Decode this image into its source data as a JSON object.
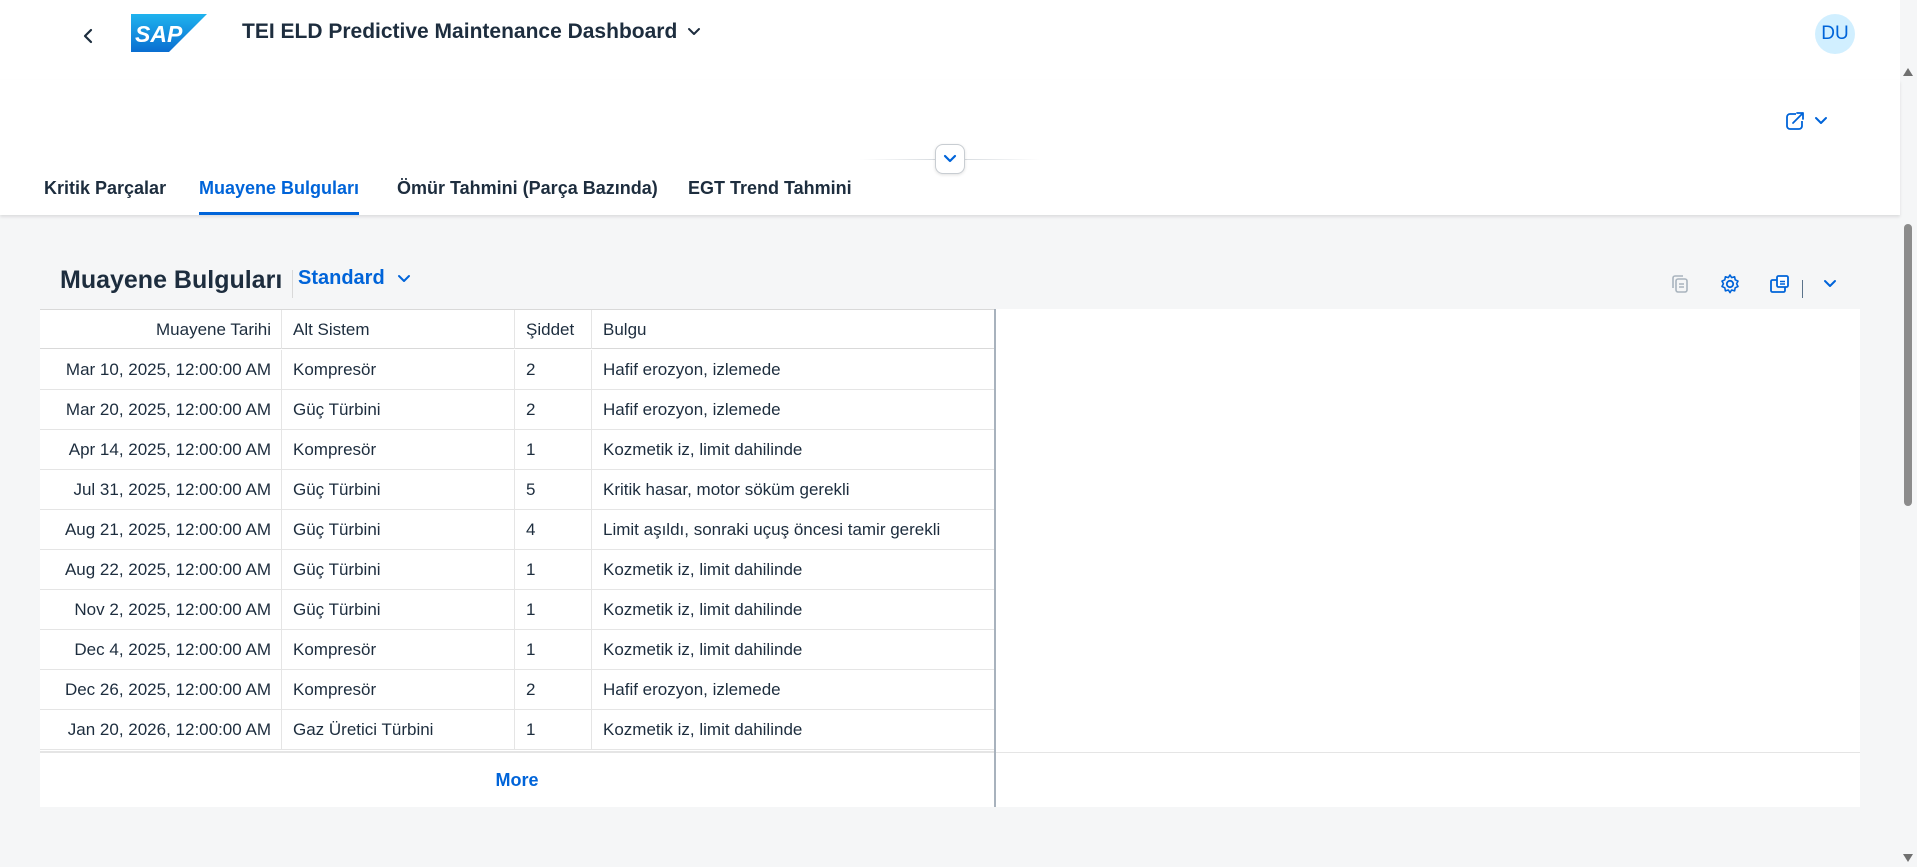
{
  "shell": {
    "title": "TEI ELD Predictive Maintenance Dashboard",
    "logo_text": "SAP",
    "avatar_initials": "DU"
  },
  "tabs": [
    {
      "label": "Kritik Parçalar",
      "active": false
    },
    {
      "label": "Muayene Bulguları",
      "active": true
    },
    {
      "label": "Ömür Tahmini (Parça Bazında)",
      "active": false
    },
    {
      "label": "EGT Trend Tahmini",
      "active": false
    }
  ],
  "table": {
    "title": "Muayene Bulguları",
    "variant": "Standard",
    "columns": [
      "Muayene Tarihi",
      "Alt Sistem",
      "Şiddet",
      "Bulgu"
    ],
    "rows": [
      [
        "Mar 10, 2025, 12:00:00 AM",
        "Kompresör",
        "2",
        "Hafif erozyon, izlemede"
      ],
      [
        "Mar 20, 2025, 12:00:00 AM",
        "Güç Türbini",
        "2",
        "Hafif erozyon, izlemede"
      ],
      [
        "Apr 14, 2025, 12:00:00 AM",
        "Kompresör",
        "1",
        "Kozmetik iz, limit dahilinde"
      ],
      [
        "Jul 31, 2025, 12:00:00 AM",
        "Güç Türbini",
        "5",
        "Kritik hasar, motor söküm gerekli"
      ],
      [
        "Aug 21, 2025, 12:00:00 AM",
        "Güç Türbini",
        "4",
        "Limit aşıldı, sonraki uçuş öncesi tamir gerekli"
      ],
      [
        "Aug 22, 2025, 12:00:00 AM",
        "Güç Türbini",
        "1",
        "Kozmetik iz, limit dahilinde"
      ],
      [
        "Nov 2, 2025, 12:00:00 AM",
        "Güç Türbini",
        "1",
        "Kozmetik iz, limit dahilinde"
      ],
      [
        "Dec 4, 2025, 12:00:00 AM",
        "Kompresör",
        "1",
        "Kozmetik iz, limit dahilinde"
      ],
      [
        "Dec 26, 2025, 12:00:00 AM",
        "Kompresör",
        "2",
        "Hafif erozyon, izlemede"
      ],
      [
        "Jan 20, 2026, 12:00:00 AM",
        "Gaz Üretici Türbini",
        "1",
        "Kozmetik iz, limit dahilinde"
      ]
    ],
    "more_label": "More"
  },
  "icons": {
    "back": "chevron-left-icon",
    "title_dropdown": "chevron-down-icon",
    "share": "share-icon",
    "collapse_header": "chevron-down-icon",
    "copy": "copy-icon",
    "settings": "gear-icon",
    "export": "export-icon"
  },
  "colors": {
    "accent": "#0064d9",
    "text": "#1d2d3e",
    "page_bg": "#f5f6f7",
    "avatar_bg": "#d1efff"
  }
}
